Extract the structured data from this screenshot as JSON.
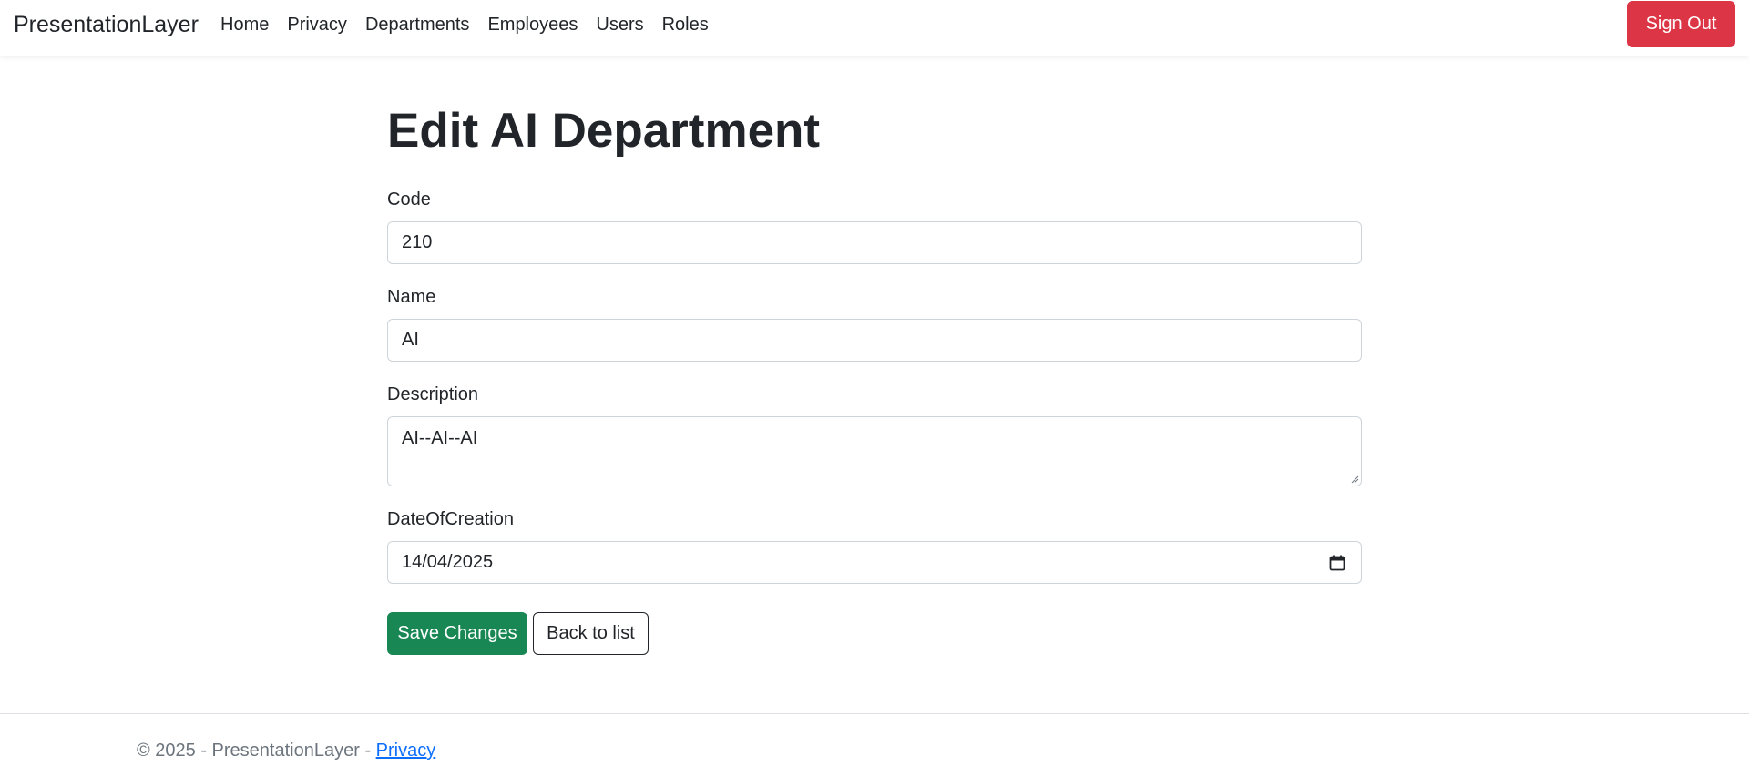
{
  "navbar": {
    "brand": "PresentationLayer",
    "links": [
      {
        "label": "Home"
      },
      {
        "label": "Privacy"
      },
      {
        "label": "Departments"
      },
      {
        "label": "Employees"
      },
      {
        "label": "Users"
      },
      {
        "label": "Roles"
      }
    ],
    "signout_label": "Sign Out"
  },
  "page": {
    "title": "Edit AI Department"
  },
  "form": {
    "code": {
      "label": "Code",
      "value": "210"
    },
    "name": {
      "label": "Name",
      "value": "AI"
    },
    "description": {
      "label": "Description",
      "value": "AI--AI--AI"
    },
    "date_of_creation": {
      "label": "DateOfCreation",
      "value": "14/04/2025"
    },
    "save_label": "Save Changes",
    "back_label": "Back to list"
  },
  "footer": {
    "text": "© 2025 - PresentationLayer - ",
    "privacy_label": "Privacy"
  },
  "colors": {
    "danger": "#dc3545",
    "success": "#198754",
    "link": "#0d6efd"
  }
}
